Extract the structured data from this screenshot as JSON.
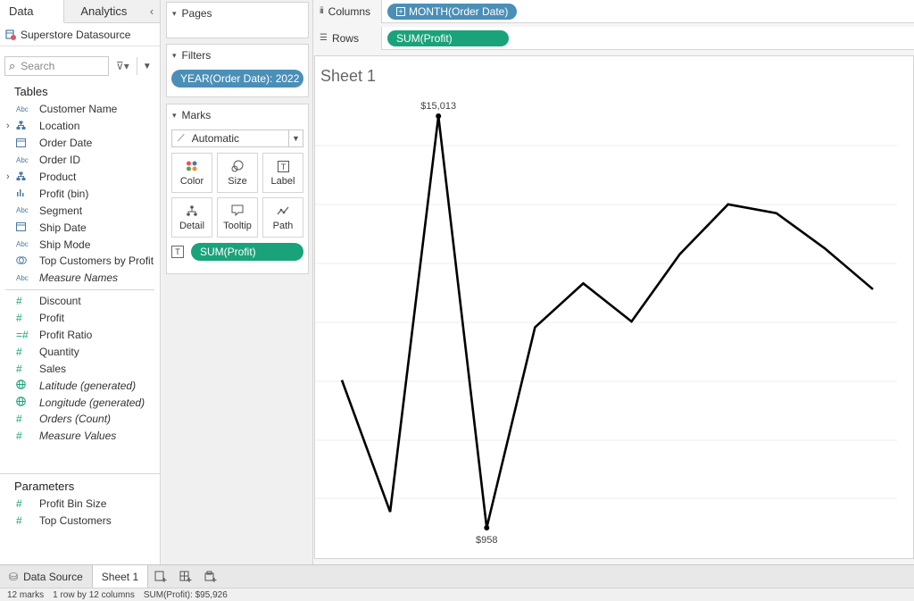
{
  "data_pane": {
    "tabs": [
      "Data",
      "Analytics"
    ],
    "datasource": "Superstore Datasource",
    "search_placeholder": "Search",
    "tables_title": "Tables",
    "dimensions": [
      {
        "label": "Customer Name",
        "type": "abc",
        "italic": false,
        "expandable": false
      },
      {
        "label": "Location",
        "type": "hier",
        "italic": false,
        "expandable": true
      },
      {
        "label": "Order Date",
        "type": "date",
        "italic": false,
        "expandable": false
      },
      {
        "label": "Order ID",
        "type": "abc",
        "italic": false,
        "expandable": false
      },
      {
        "label": "Product",
        "type": "hier",
        "italic": false,
        "expandable": true
      },
      {
        "label": "Profit (bin)",
        "type": "bin",
        "italic": false,
        "expandable": false
      },
      {
        "label": "Segment",
        "type": "abc",
        "italic": false,
        "expandable": false
      },
      {
        "label": "Ship Date",
        "type": "date",
        "italic": false,
        "expandable": false
      },
      {
        "label": "Ship Mode",
        "type": "abc",
        "italic": false,
        "expandable": false
      },
      {
        "label": "Top Customers by Profit",
        "type": "set",
        "italic": false,
        "expandable": false
      },
      {
        "label": "Measure Names",
        "type": "abc",
        "italic": true,
        "expandable": false
      }
    ],
    "measures": [
      {
        "label": "Discount",
        "type": "num",
        "italic": false
      },
      {
        "label": "Profit",
        "type": "num",
        "italic": false
      },
      {
        "label": "Profit Ratio",
        "type": "calc",
        "italic": false
      },
      {
        "label": "Quantity",
        "type": "num",
        "italic": false
      },
      {
        "label": "Sales",
        "type": "num",
        "italic": false
      },
      {
        "label": "Latitude (generated)",
        "type": "globe",
        "italic": true
      },
      {
        "label": "Longitude (generated)",
        "type": "globe",
        "italic": true
      },
      {
        "label": "Orders (Count)",
        "type": "num",
        "italic": true
      },
      {
        "label": "Measure Values",
        "type": "num",
        "italic": true
      }
    ],
    "parameters_title": "Parameters",
    "parameters": [
      {
        "label": "Profit Bin Size"
      },
      {
        "label": "Top Customers"
      }
    ]
  },
  "cards": {
    "pages_title": "Pages",
    "filters_title": "Filters",
    "filter_pill": "YEAR(Order Date): 2022",
    "marks_title": "Marks",
    "mark_type": "Automatic",
    "mark_buttons": {
      "color": "Color",
      "size": "Size",
      "label": "Label",
      "detail": "Detail",
      "tooltip": "Tooltip",
      "path": "Path"
    },
    "marks_field": "SUM(Profit)"
  },
  "shelves": {
    "columns_label": "Columns",
    "columns_pill": "MONTH(Order Date)",
    "rows_label": "Rows",
    "rows_pill": "SUM(Profit)"
  },
  "sheet": {
    "title": "Sheet 1",
    "max_label": "$15,013",
    "min_label": "$958"
  },
  "chart_data": {
    "type": "line",
    "series": [
      {
        "values": [
          6000,
          1500,
          15013,
          958,
          7800,
          9300,
          8000,
          10300,
          12000,
          11700,
          10500,
          9100
        ]
      }
    ],
    "annotations": [
      "$15,013",
      "$958"
    ],
    "line_color": "#000000"
  },
  "tabbar": {
    "data_source_tab": "Data Source",
    "sheet_tab": "Sheet 1"
  },
  "status": {
    "marks": "12 marks",
    "dims": "1 row by 12 columns",
    "sum": "SUM(Profit): $95,926"
  }
}
